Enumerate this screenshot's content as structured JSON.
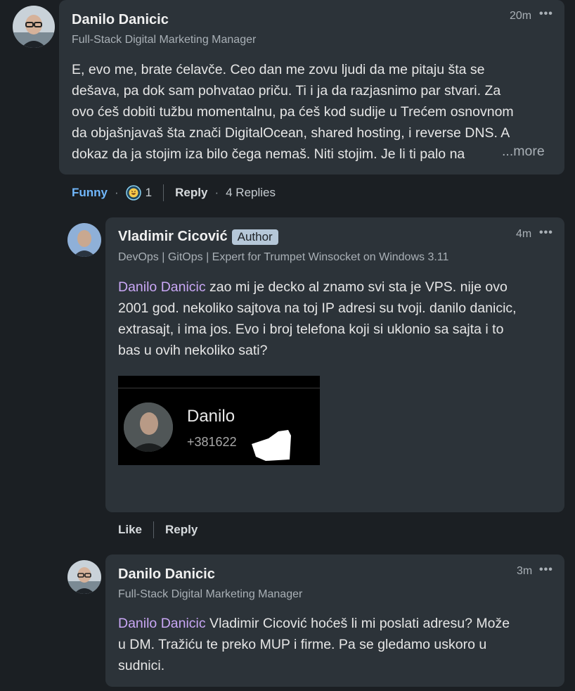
{
  "comment1": {
    "author": "Danilo Danicic",
    "headline": "Full-Stack Digital Marketing Manager",
    "time": "20m",
    "lines": [
      "E, evo me, brate ćelavče. Ceo dan me zovu ljudi da me pitaju šta se",
      "dešava, pa dok sam pohvatao priču. Ti i ja da razjasnimo par stvari. Za",
      "ovo ćeš dobiti tužbu momentalnu, pa ćeš kod sudije u Trećem osnovnom",
      "da objašnjavaš šta znači DigitalOcean, shared hosting, i reverse DNS. A",
      "dokaz da ja stojim iza bilo čega nemaš. Niti stojim. Je li ti palo na"
    ],
    "more_label": "...more",
    "actions": {
      "reaction_label": "Funny",
      "reaction_count": "1",
      "reply_label": "Reply",
      "replies_count": "4 Replies"
    }
  },
  "reply1": {
    "author": "Vladimir Cicović",
    "badge": "Author",
    "headline": "DevOps | GitOps | Expert for Trumpet Winsocket on Windows 3.11",
    "time": "4m",
    "mention": "Danilo Danicic",
    "lines": [
      " zao mi je decko al znamo svi sta je VPS. nije ovo",
      "2001 god. nekoliko sajtova na toj IP adresi su tvoji. danilo danicic,",
      "extrasajt, i ima jos. Evo i broj telefona koji si uklonio sa sajta i to",
      "bas u ovih nekoliko sati?"
    ],
    "image": {
      "contact_name": "Danilo",
      "contact_number": "+381622"
    },
    "actions": {
      "like_label": "Like",
      "reply_label": "Reply"
    }
  },
  "reply2": {
    "author": "Danilo Danicic",
    "headline": "Full-Stack Digital Marketing Manager",
    "time": "3m",
    "mention": "Danilo Danicic",
    "lines": [
      " Vladimir Cicović hoćeš li mi poslati adresu? Može",
      "u DM. Tražiću te preko MUP i firme. Pa se gledamo uskoro u",
      "sudnici."
    ]
  },
  "colors": {
    "background": "#1b1f23",
    "bubble": "#2c3339",
    "mention": "#c9a7f5",
    "funny": "#71b7fb",
    "badge": "#b5c7d8"
  },
  "icons": {
    "more": "ellipsis-icon",
    "reaction": "funny-reaction-icon"
  }
}
